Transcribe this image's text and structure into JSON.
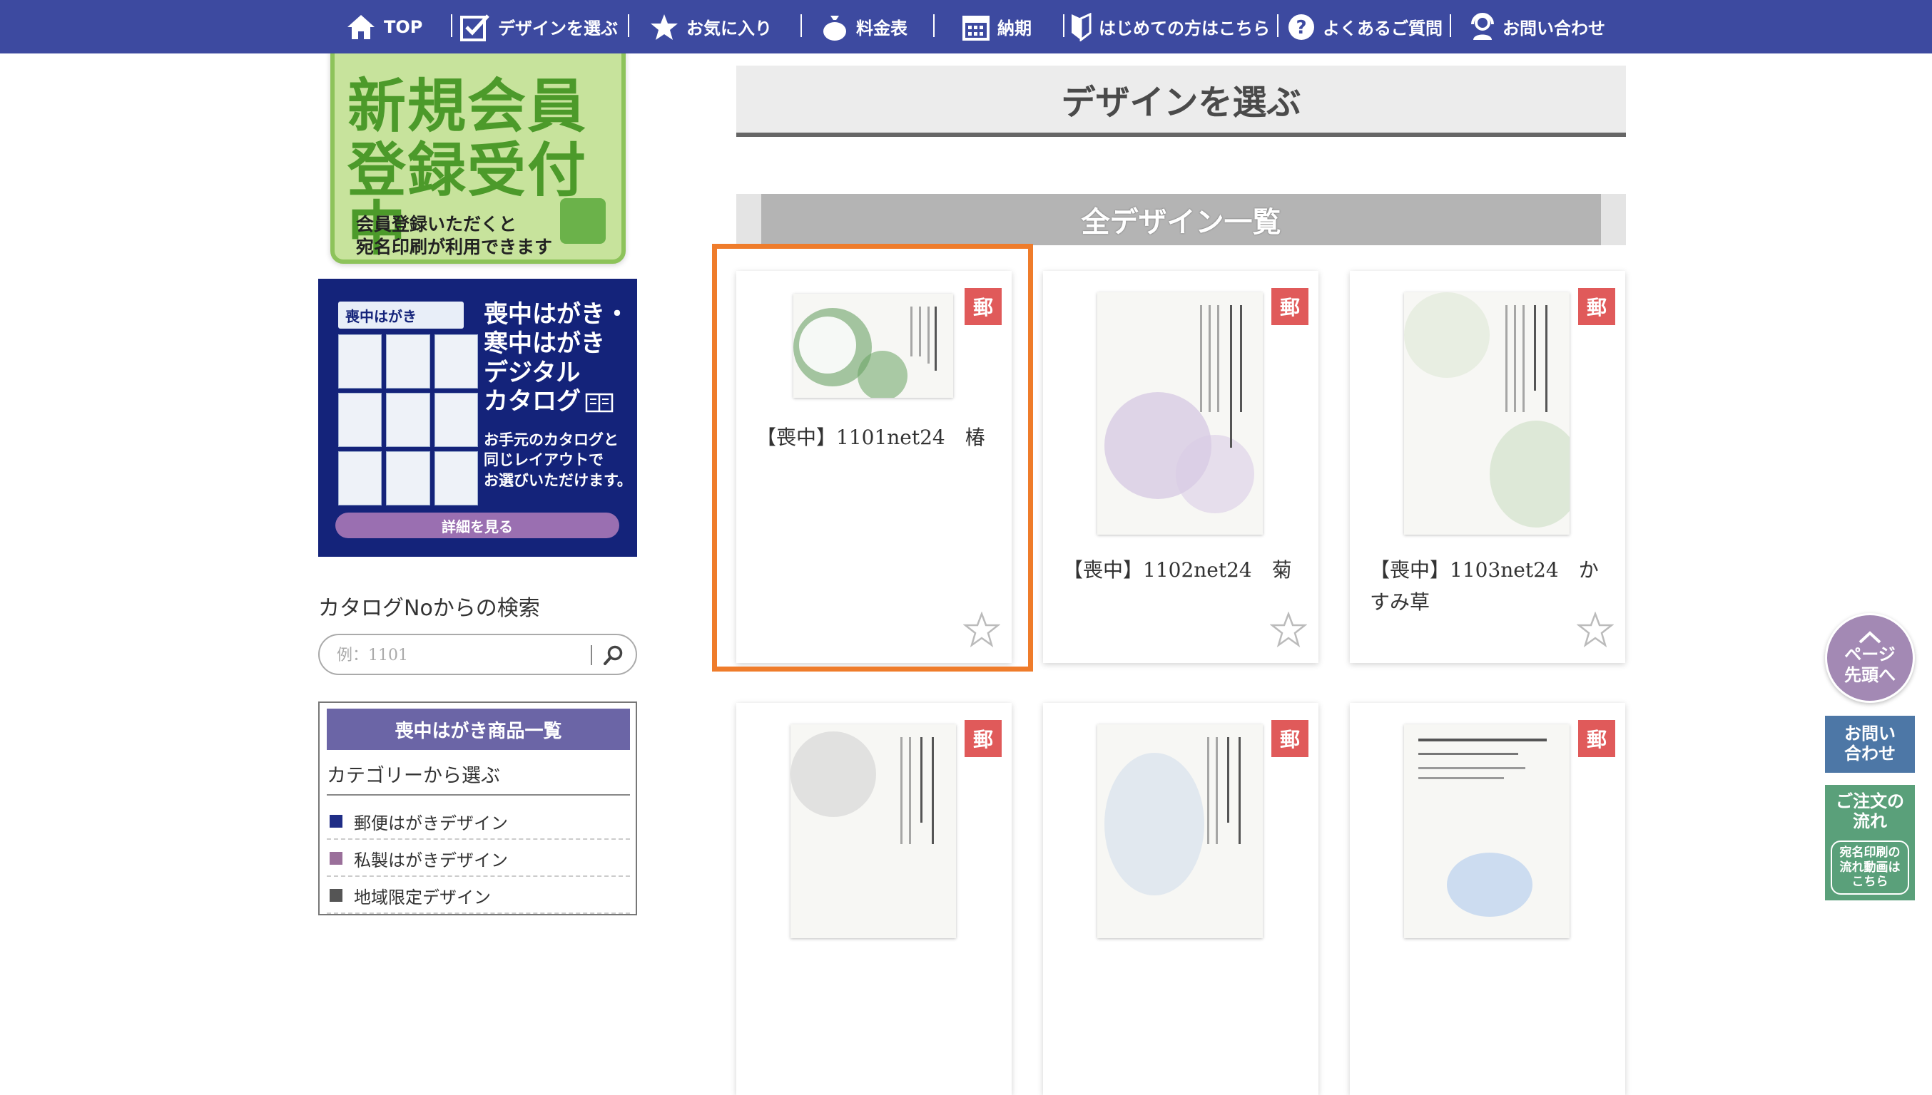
{
  "nav": {
    "items": [
      {
        "label": "TOP",
        "icon": "home-icon"
      },
      {
        "label": "デザインを選ぶ",
        "icon": "checklist-icon"
      },
      {
        "label": "お気に入り",
        "icon": "star-icon"
      },
      {
        "label": "料金表",
        "icon": "money-bag-icon"
      },
      {
        "label": "納期",
        "icon": "calendar-icon"
      },
      {
        "label": "はじめての方はこちら",
        "icon": "beginner-mark-icon"
      },
      {
        "label": "よくあるご質問",
        "icon": "question-icon"
      },
      {
        "label": "お問い合わせ",
        "icon": "headset-icon"
      }
    ]
  },
  "sidebar": {
    "member_banner": {
      "line1": "新規会員",
      "line2": "登録受付中",
      "line3": "会員登録いただくと",
      "line4": "宛名印刷が利用できます"
    },
    "catalog_banner": {
      "tag": "喪中はがき",
      "title1": "喪中はがき・",
      "title2": "寒中はがき",
      "title3": "デジタル",
      "title4": "カタログ",
      "sub1": "お手元のカタログと",
      "sub2": "同じレイアウトで",
      "sub3": "お選びいただけます。",
      "button": "詳細を見る"
    },
    "search": {
      "title": "カタログNoからの検索",
      "placeholder": "例：1101"
    },
    "categories": {
      "header": "喪中はがき商品一覧",
      "subtitle": "カテゴリーから選ぶ",
      "items": [
        {
          "label": "郵便はがきデザイン",
          "color": "#1f2d86"
        },
        {
          "label": "私製はがきデザイン",
          "color": "#9a6f9a"
        },
        {
          "label": "地域限定デザイン",
          "color": "#555555"
        }
      ]
    }
  },
  "main": {
    "page_title": "デザインを選ぶ",
    "section_title": "全デザイン一覧",
    "postal_badge": "郵",
    "cards": [
      {
        "title": "【喪中】1101net24　椿",
        "selected": true
      },
      {
        "title": "【喪中】1102net24　菊",
        "selected": false
      },
      {
        "title": "【喪中】1103net24　かすみ草",
        "selected": false
      },
      {
        "title": "",
        "selected": false
      },
      {
        "title": "",
        "selected": false
      },
      {
        "title": "",
        "selected": false
      }
    ]
  },
  "floating": {
    "top_button_line1": "ページ",
    "top_button_line2": "先頭へ",
    "contact_line1": "お問い",
    "contact_line2": "合わせ",
    "order_line1": "ご注文の",
    "order_line2": "流れ",
    "order_video1": "宛名印刷の",
    "order_video2": "流れ動画は",
    "order_video3": "こちら"
  },
  "colors": {
    "nav_bg": "#3d4aa0",
    "selection": "#ef7c2b",
    "postal_badge": "#e05a5a",
    "category_header": "#6b65a6"
  }
}
